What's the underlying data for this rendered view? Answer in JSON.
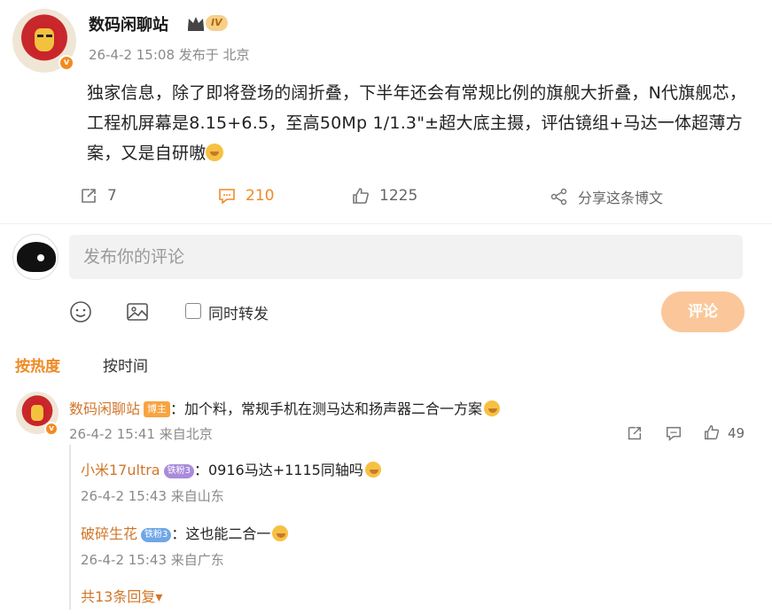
{
  "post": {
    "author": "数码闲聊站",
    "level_badge": "IV",
    "verified_badge": "v",
    "meta": "26-4-2 15:08 发布于 北京",
    "text": "独家信息，除了即将登场的阔折叠，下半年还会有常规比例的旗舰大折叠，N代旗舰芯，工程机屏幕是8.15+6.5，至高50Mp 1/1.3\"±超大底主摄，评估镜组+马达一体超薄方案，又是自研嗷",
    "actions": {
      "repost": "7",
      "comment": "210",
      "like": "1225",
      "share": "分享这条博文"
    }
  },
  "composer": {
    "placeholder": "发布你的评论",
    "repost_checkbox": "同时转发",
    "submit": "评论"
  },
  "sort": {
    "hot": "按热度",
    "time": "按时间"
  },
  "comments": [
    {
      "user": "数码闲聊站",
      "tag": "博主",
      "text": "：加个料，常规手机在测马达和扬声器二合一方案",
      "meta": "26-4-2 15:41 来自北京",
      "likes": "49",
      "replies": [
        {
          "user": "小米17ultra",
          "tag": "铁粉3",
          "text": "：0916马达+1115同轴吗",
          "meta": "26-4-2 15:43 来自山东"
        },
        {
          "user": "破碎生花",
          "tag": "铁粉3",
          "text": "：这也能二合一",
          "meta": "26-4-2 15:43 来自广东"
        }
      ],
      "reply_more": "共13条回复▾"
    }
  ],
  "colors": {
    "accent": "#f08a24",
    "button": "#fbc79a",
    "name": "#d1762a"
  },
  "icons": [
    "repost-icon",
    "comment-icon",
    "like-icon",
    "share-icon",
    "emoji-icon",
    "image-icon",
    "crown-icon"
  ]
}
